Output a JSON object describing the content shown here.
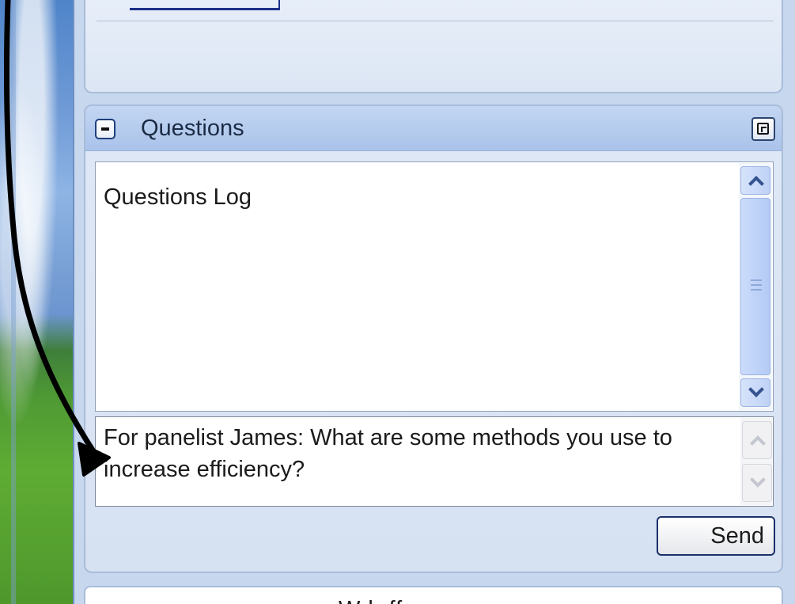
{
  "questions_panel": {
    "title": "Questions",
    "log_label": "Questions Log",
    "question_text": "For panelist James: What are some methods you use to increase efficiency?",
    "send_label": "Send"
  },
  "bottom_panel": {
    "title_fragment": "W  b   ff"
  },
  "icons": {
    "collapse": "minus-icon",
    "popout": "popout-icon",
    "scroll_up": "chevron-up-icon",
    "scroll_down": "chevron-down-icon"
  },
  "colors": {
    "panel_header": "#aac3ea",
    "panel_border": "#a9bcd9",
    "accent": "#1c2f8a",
    "annotation_arrow": "#000000"
  }
}
